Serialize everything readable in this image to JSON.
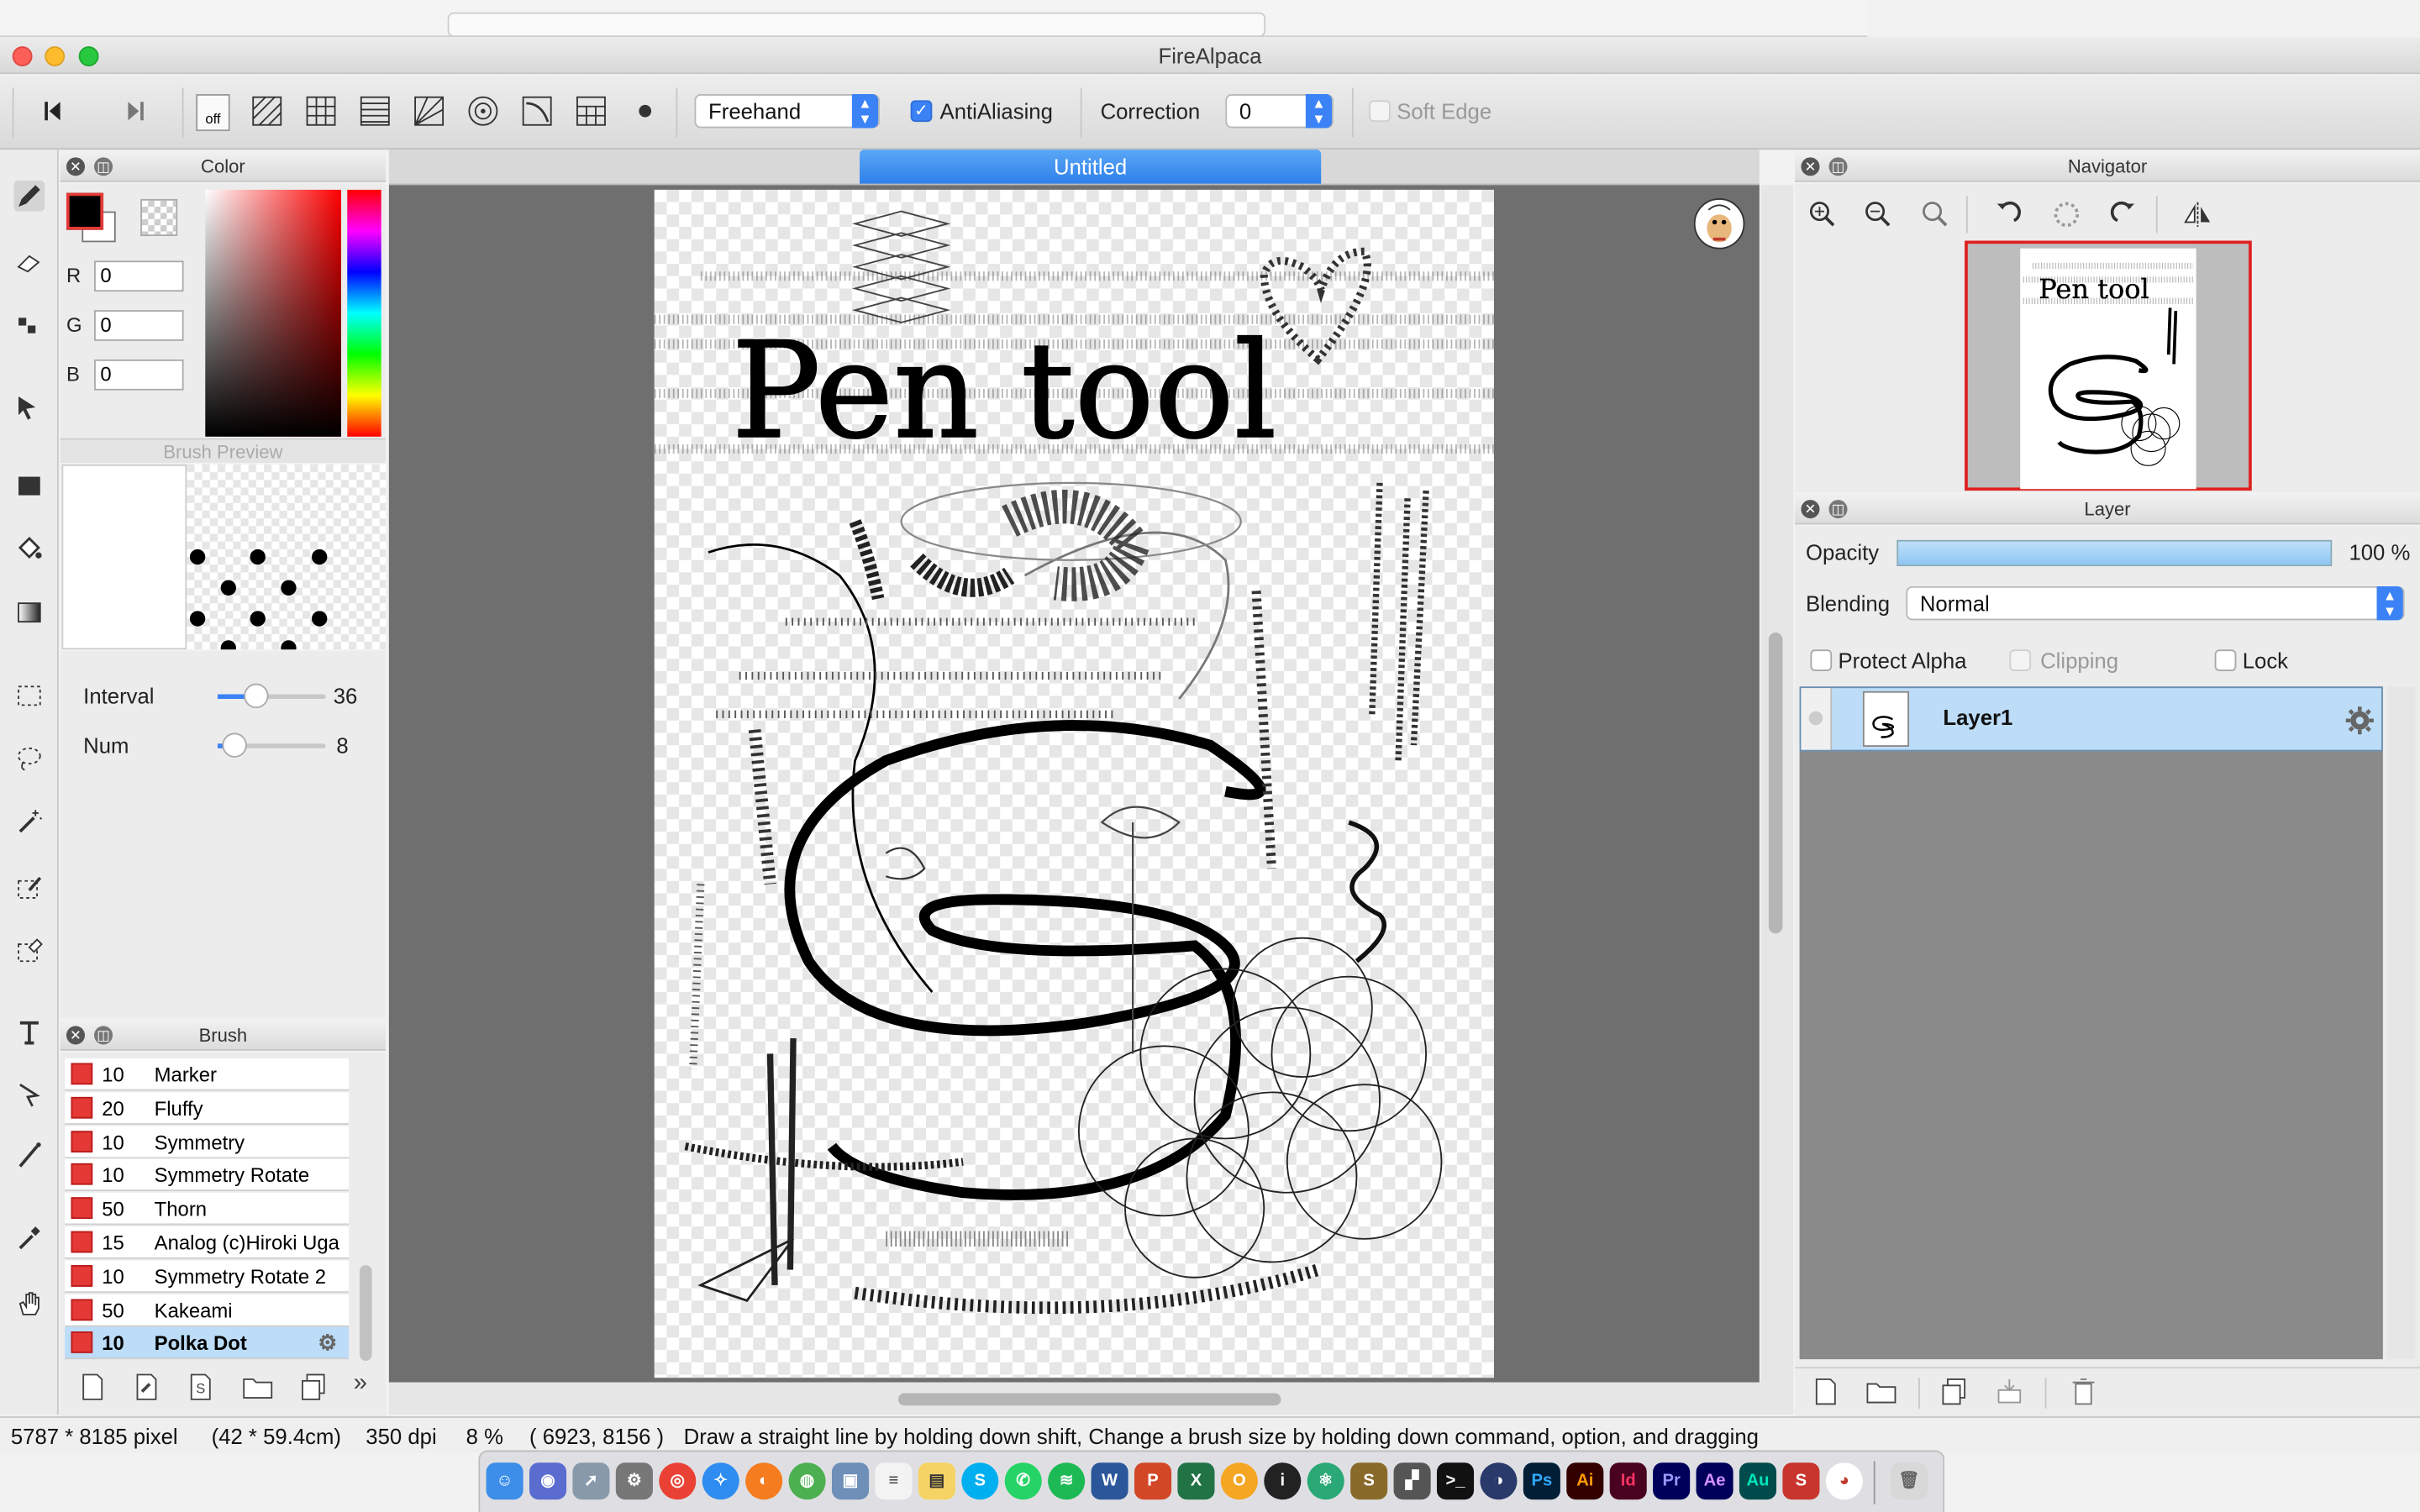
{
  "window": {
    "title": "FireAlpaca"
  },
  "toolbar": {
    "mode": "Freehand",
    "antialiasing_label": "AntiAliasing",
    "antialiasing_checked": true,
    "correction_label": "Correction",
    "correction_value": "0",
    "soft_edge_label": "Soft Edge",
    "snap_off_label": "off"
  },
  "document": {
    "tab_title": "Untitled"
  },
  "color_panel": {
    "title": "Color",
    "r_label": "R",
    "r_value": "0",
    "g_label": "G",
    "g_value": "0",
    "b_label": "B",
    "b_value": "0",
    "foreground": "#000000"
  },
  "brush_preview": {
    "title": "Brush Preview",
    "interval_label": "Interval",
    "interval_value": "36",
    "num_label": "Num",
    "num_value": "8"
  },
  "brush_panel": {
    "title": "Brush",
    "items": [
      {
        "size": "10",
        "name": "Marker"
      },
      {
        "size": "20",
        "name": "Fluffy"
      },
      {
        "size": "10",
        "name": "Symmetry"
      },
      {
        "size": "10",
        "name": "Symmetry Rotate"
      },
      {
        "size": "50",
        "name": "Thorn"
      },
      {
        "size": "15",
        "name": "Analog (c)Hiroki Uga"
      },
      {
        "size": "10",
        "name": "Symmetry Rotate 2"
      },
      {
        "size": "50",
        "name": "Kakeami"
      },
      {
        "size": "10",
        "name": "Polka Dot"
      }
    ],
    "selected": "Polka Dot"
  },
  "navigator": {
    "title": "Navigator"
  },
  "layer_panel": {
    "title": "Layer",
    "opacity_label": "Opacity",
    "opacity_value": "100 %",
    "blending_label": "Blending",
    "blending_value": "Normal",
    "protect_alpha_label": "Protect Alpha",
    "clipping_label": "Clipping",
    "lock_label": "Lock",
    "layers": [
      {
        "name": "Layer1"
      }
    ]
  },
  "status": {
    "pixels": "5787 * 8185 pixel",
    "physical": "(42 * 59.4cm)",
    "dpi": "350 dpi",
    "zoom": "8 %",
    "cursor": "( 6923, 8156 )",
    "hint": "Draw a straight line by holding down shift, Change a brush size by holding down command, option, and dragging"
  },
  "canvas_text": "Pen tool"
}
